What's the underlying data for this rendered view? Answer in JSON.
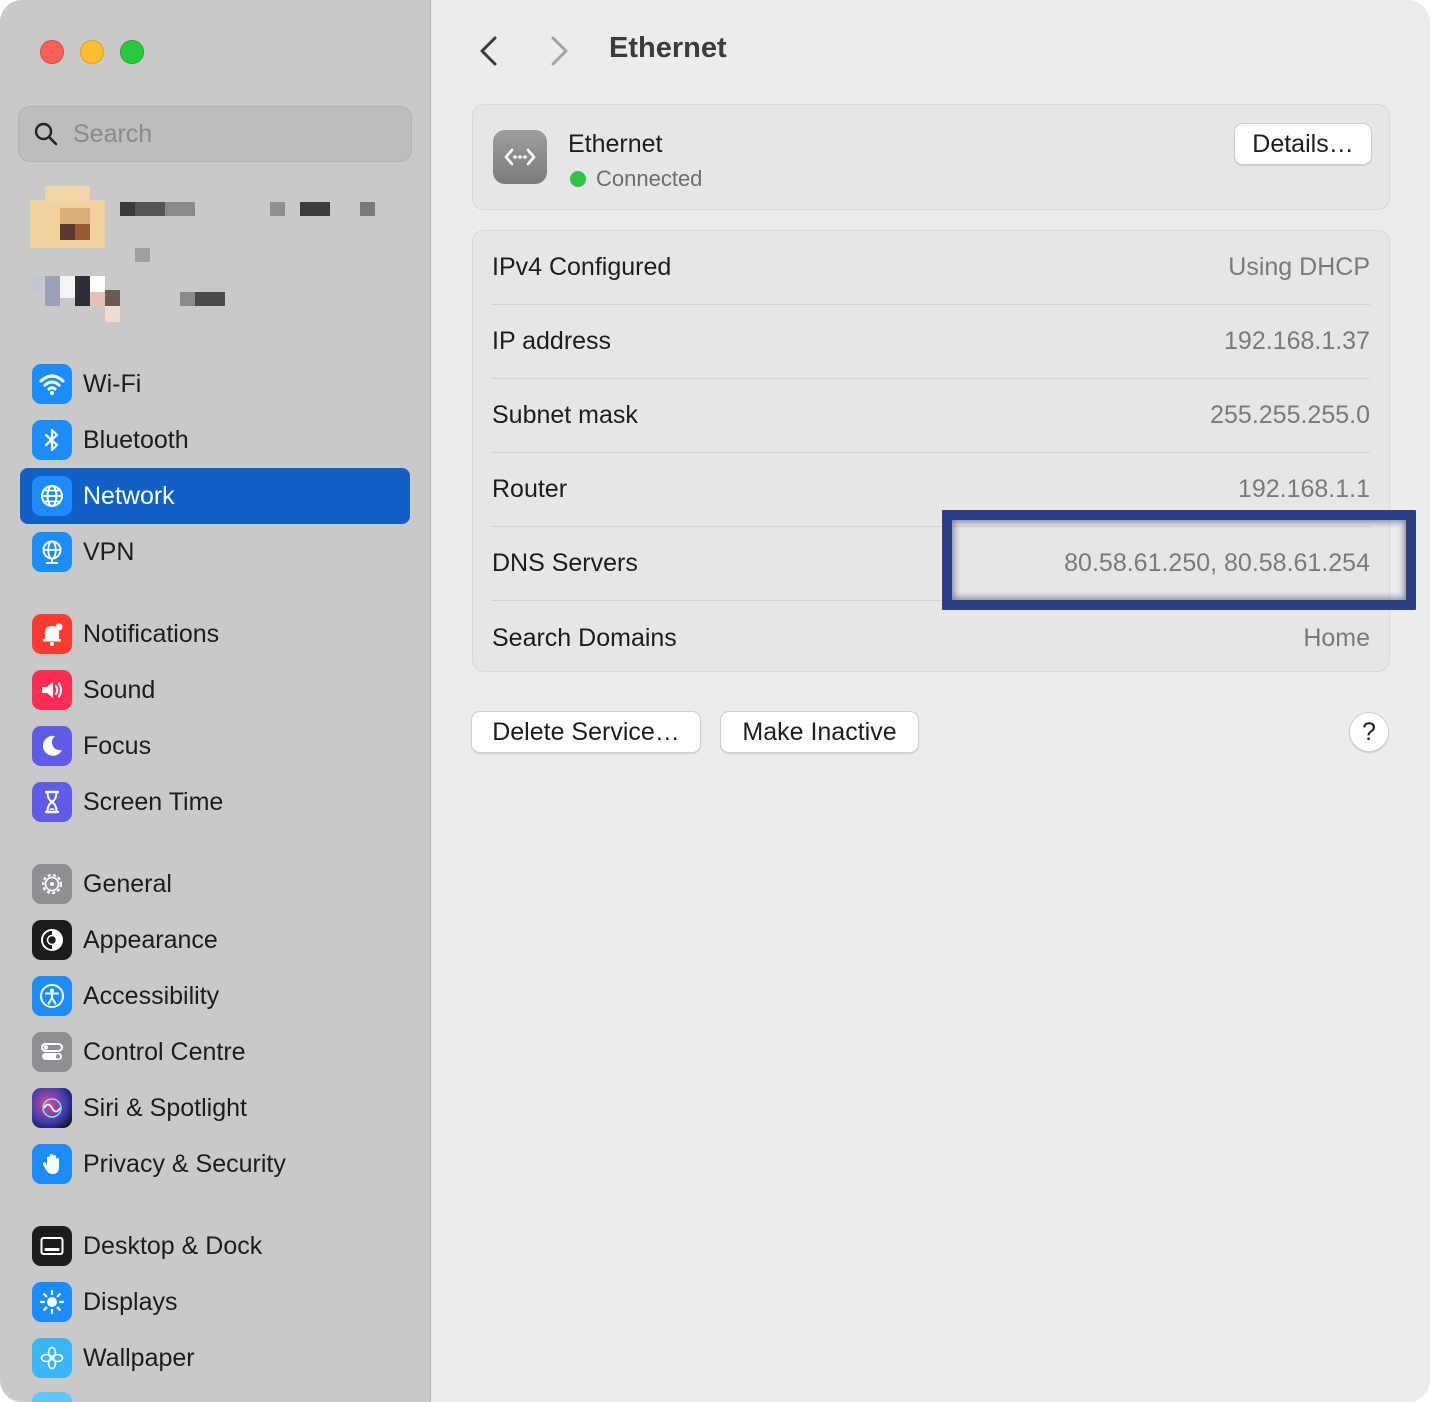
{
  "search": {
    "placeholder": "Search"
  },
  "sidebar": {
    "items": [
      {
        "label": "Wi-Fi",
        "icon": "wifi-icon",
        "color": "#1a8cff",
        "selected": false
      },
      {
        "label": "Bluetooth",
        "icon": "bluetooth-icon",
        "color": "#1a8cff",
        "selected": false
      },
      {
        "label": "Network",
        "icon": "globe-icon",
        "color": "#1a8cff",
        "selected": true
      },
      {
        "label": "VPN",
        "icon": "vpn-globe-icon",
        "color": "#1a8cff",
        "selected": false
      },
      {
        "label": "Notifications",
        "icon": "bell-icon",
        "color": "#ff3b30",
        "selected": false
      },
      {
        "label": "Sound",
        "icon": "speaker-icon",
        "color": "#ff2d55",
        "selected": false
      },
      {
        "label": "Focus",
        "icon": "moon-icon",
        "color": "#5e5ce6",
        "selected": false
      },
      {
        "label": "Screen Time",
        "icon": "hourglass-icon",
        "color": "#5e5ce6",
        "selected": false
      },
      {
        "label": "General",
        "icon": "gear-icon",
        "color": "#8e8e93",
        "selected": false
      },
      {
        "label": "Appearance",
        "icon": "appearance-icon",
        "color": "#1c1c1e",
        "selected": false
      },
      {
        "label": "Accessibility",
        "icon": "accessibility-icon",
        "color": "#1a8cff",
        "selected": false
      },
      {
        "label": "Control Centre",
        "icon": "control-centre-icon",
        "color": "#8e8e93",
        "selected": false
      },
      {
        "label": "Siri & Spotlight",
        "icon": "siri-icon",
        "color": "#2b2b6b",
        "selected": false
      },
      {
        "label": "Privacy & Security",
        "icon": "hand-icon",
        "color": "#1a8cff",
        "selected": false
      },
      {
        "label": "Desktop & Dock",
        "icon": "dock-icon",
        "color": "#1c1c1e",
        "selected": false
      },
      {
        "label": "Displays",
        "icon": "sun-icon",
        "color": "#1a8cff",
        "selected": false
      },
      {
        "label": "Wallpaper",
        "icon": "flower-icon",
        "color": "#38b6f5",
        "selected": false
      }
    ]
  },
  "header": {
    "title": "Ethernet"
  },
  "service": {
    "name": "Ethernet",
    "status": "Connected",
    "status_color": "#2dc343",
    "details_label": "Details…"
  },
  "info": {
    "rows": [
      {
        "label": "IPv4 Configured",
        "value": "Using DHCP"
      },
      {
        "label": "IP address",
        "value": "192.168.1.37"
      },
      {
        "label": "Subnet mask",
        "value": "255.255.255.0"
      },
      {
        "label": "Router",
        "value": "192.168.1.1"
      },
      {
        "label": "DNS Servers",
        "value": "80.58.61.250, 80.58.61.254"
      },
      {
        "label": "Search Domains",
        "value": "Home"
      }
    ]
  },
  "actions": {
    "delete_label": "Delete Service…",
    "inactive_label": "Make Inactive",
    "help_label": "?"
  },
  "colors": {
    "accent": "#1160c8",
    "highlight_border": "#2c3e84"
  }
}
